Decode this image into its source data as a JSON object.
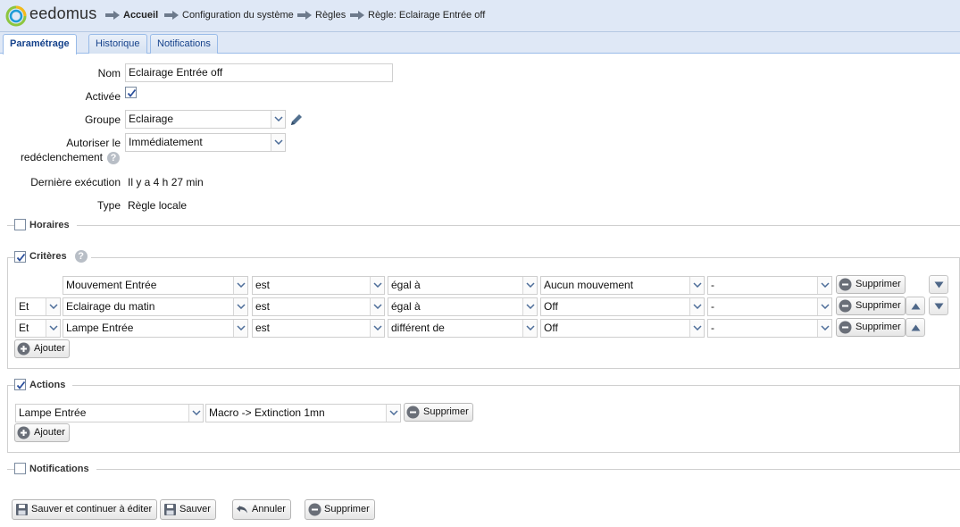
{
  "brand": {
    "name": "eedomus"
  },
  "breadcrumb": [
    "Accueil",
    "Configuration du système",
    "Règles",
    "Règle: Eclairage Entrée off"
  ],
  "tabs": [
    {
      "label": "Paramétrage",
      "active": true
    },
    {
      "label": "Historique",
      "active": false
    },
    {
      "label": "Notifications",
      "active": false
    }
  ],
  "form": {
    "nom_label": "Nom",
    "nom_value": "Eclairage Entrée off",
    "activee_label": "Activée",
    "activee_checked": true,
    "groupe_label": "Groupe",
    "groupe_value": "Eclairage",
    "autoriser_label_1": "Autoriser le",
    "autoriser_label_2": "redéclenchement",
    "autoriser_value": "Immédiatement",
    "derniere_label": "Dernière exécution",
    "derniere_value": "Il y a 4 h 27 min",
    "type_label": "Type",
    "type_value": "Règle locale"
  },
  "sections": {
    "horaires": {
      "label": "Horaires",
      "checked": false
    },
    "criteres": {
      "label": "Critères",
      "checked": true
    },
    "actions": {
      "label": "Actions",
      "checked": true
    },
    "notifications": {
      "label": "Notifications",
      "checked": false
    }
  },
  "criteria": [
    {
      "connector": "",
      "device": "Mouvement Entrée",
      "op": "est",
      "comparison": "égal à",
      "value": "Aucun mouvement",
      "extra": "-",
      "delete": "Supprimer",
      "up": false,
      "down": true
    },
    {
      "connector": "Et",
      "device": "Eclairage du matin",
      "op": "est",
      "comparison": "égal à",
      "value": "Off",
      "extra": "-",
      "delete": "Supprimer",
      "up": true,
      "down": true
    },
    {
      "connector": "Et",
      "device": "Lampe Entrée",
      "op": "est",
      "comparison": "différent de",
      "value": "Off",
      "extra": "-",
      "delete": "Supprimer",
      "up": true,
      "down": false
    }
  ],
  "criteria_add": "Ajouter",
  "actions": [
    {
      "device": "Lampe Entrée",
      "action": "Macro -> Extinction 1mn",
      "delete": "Supprimer"
    }
  ],
  "actions_add": "Ajouter",
  "bottom": {
    "save_continue": "Sauver et continuer à éditer",
    "save": "Sauver",
    "cancel": "Annuler",
    "delete": "Supprimer"
  },
  "colors": {
    "header_bg": "#dfe8f6",
    "tab_text": "#15428b",
    "logo_green": "#8dc63f",
    "logo_blue": "#1e9bd7",
    "logo_yellow": "#f5b91a"
  }
}
